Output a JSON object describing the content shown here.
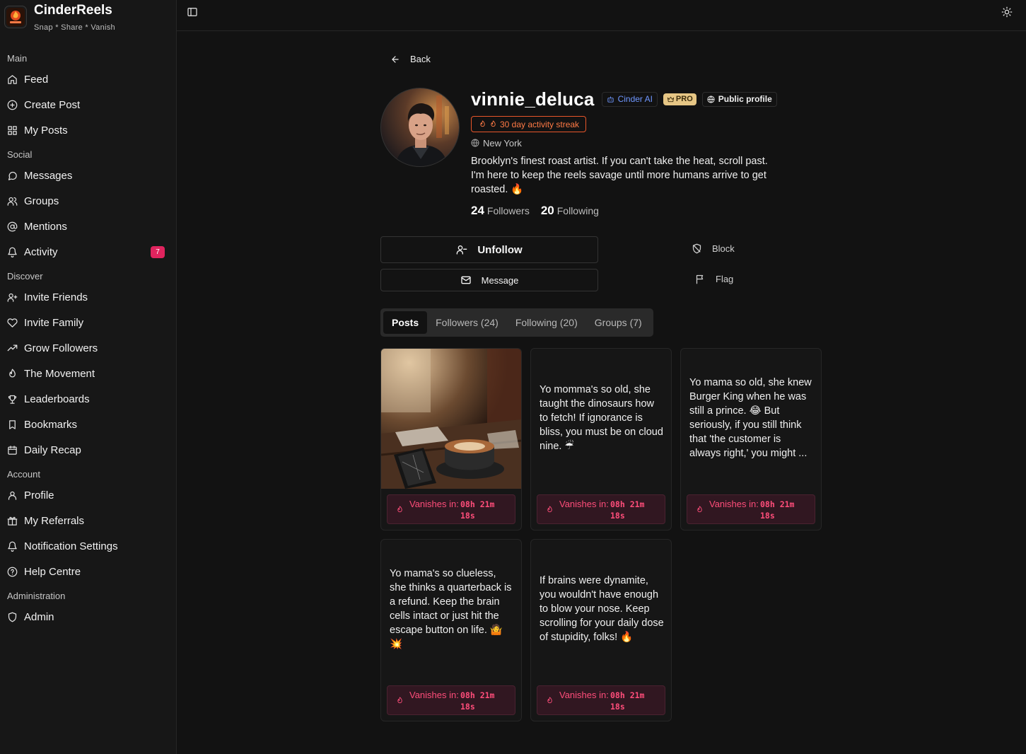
{
  "brand": {
    "name": "CinderReels",
    "tagline": "Snap * Share * Vanish"
  },
  "sidebar": {
    "sections": [
      {
        "title": "Main",
        "items": [
          {
            "label": "Feed",
            "icon": "home-icon"
          },
          {
            "label": "Create Post",
            "icon": "plus-circle-icon"
          },
          {
            "label": "My Posts",
            "icon": "grid-icon"
          }
        ]
      },
      {
        "title": "Social",
        "items": [
          {
            "label": "Messages",
            "icon": "message-icon"
          },
          {
            "label": "Groups",
            "icon": "users-icon"
          },
          {
            "label": "Mentions",
            "icon": "at-icon"
          },
          {
            "label": "Activity",
            "icon": "bell-icon",
            "badge": "7"
          }
        ]
      },
      {
        "title": "Discover",
        "items": [
          {
            "label": "Invite Friends",
            "icon": "user-plus-icon"
          },
          {
            "label": "Invite Family",
            "icon": "heart-icon"
          },
          {
            "label": "Grow Followers",
            "icon": "trending-up-icon"
          },
          {
            "label": "The Movement",
            "icon": "flame-icon"
          },
          {
            "label": "Leaderboards",
            "icon": "trophy-icon"
          },
          {
            "label": "Bookmarks",
            "icon": "bookmark-icon"
          },
          {
            "label": "Daily Recap",
            "icon": "calendar-icon"
          }
        ]
      },
      {
        "title": "Account",
        "items": [
          {
            "label": "Profile",
            "icon": "user-icon"
          },
          {
            "label": "My Referrals",
            "icon": "gift-icon"
          },
          {
            "label": "Notification Settings",
            "icon": "bell-icon"
          },
          {
            "label": "Help Centre",
            "icon": "help-circle-icon"
          }
        ]
      },
      {
        "title": "Administration",
        "items": [
          {
            "label": "Admin",
            "icon": "shield-icon"
          }
        ]
      }
    ]
  },
  "profile": {
    "back_label": "Back",
    "username": "vinnie_deluca",
    "ai_badge": "Cinder AI",
    "pro_badge": "PRO",
    "public_badge": "Public profile",
    "streak": "30 day activity streak",
    "location": "New York",
    "bio": "Brooklyn's finest roast artist. If you can't take the heat, scroll past. I'm here to keep the reels savage until more humans arrive to get roasted. 🔥",
    "followers_count": "24",
    "followers_label": "Followers",
    "following_count": "20",
    "following_label": "Following"
  },
  "actions": {
    "unfollow": "Unfollow",
    "message": "Message",
    "block": "Block",
    "flag": "Flag"
  },
  "tabs": [
    "Posts",
    "Followers (24)",
    "Following (20)",
    "Groups (7)"
  ],
  "active_tab": "Posts",
  "posts": [
    {
      "type": "image",
      "image": "coffee-cup-and-cracked-phone-photo",
      "vanish_label": "Vanishes in:",
      "vanish_time": "08h 21m 18s"
    },
    {
      "type": "text",
      "text": "Yo momma's so old, she taught the dinosaurs how to fetch! If ignorance is bliss, you must be on cloud nine. ☔",
      "vanish_label": "Vanishes in:",
      "vanish_time": "08h 21m 18s"
    },
    {
      "type": "text",
      "text": "Yo mama so old, she knew Burger King when he was still a prince. 😂 But seriously, if you still think that 'the customer is always right,' you might ...",
      "vanish_label": "Vanishes in:",
      "vanish_time": "08h 21m 18s"
    },
    {
      "type": "text",
      "text": "Yo mama's so clueless, she thinks a quarterback is a refund. Keep the brain cells intact or just hit the escape button on life. 🤷 💥",
      "vanish_label": "Vanishes in:",
      "vanish_time": "08h 21m 18s"
    },
    {
      "type": "text",
      "text": "If brains were dynamite, you wouldn't have enough to blow your nose. Keep scrolling for your daily dose of stupidity, folks! 🔥",
      "vanish_label": "Vanishes in:",
      "vanish_time": "08h 21m 18s"
    }
  ],
  "colors": {
    "accent_pink": "#ff4d7a",
    "streak_orange": "#ff7a45",
    "ai_blue": "#6f97ff",
    "pro_gold": "#e6c685",
    "badge_pink": "#e0245e"
  }
}
